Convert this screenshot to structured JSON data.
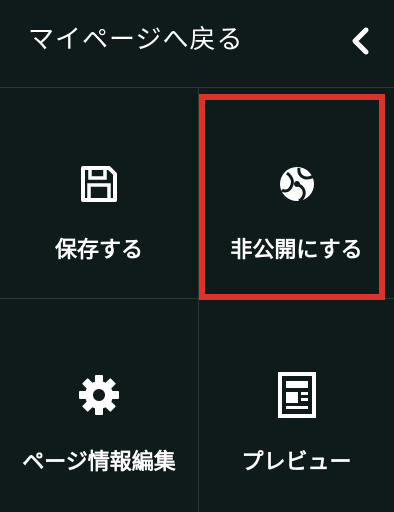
{
  "header": {
    "back_label": "マイページへ戻る",
    "collapse_icon": "chevron-left-icon"
  },
  "actions": [
    {
      "id": "save",
      "label": "保存する",
      "icon": "floppy-disk-icon"
    },
    {
      "id": "unpublish",
      "label": "非公開にする",
      "icon": "globe-icon",
      "highlighted": true
    },
    {
      "id": "page-info",
      "label": "ページ情報編集",
      "icon": "gear-icon"
    },
    {
      "id": "preview",
      "label": "プレビュー",
      "icon": "document-preview-icon"
    }
  ],
  "colors": {
    "background": "#0f1a1b",
    "divider": "#2a3536",
    "highlight": "#d9342b",
    "text": "#ffffff"
  }
}
